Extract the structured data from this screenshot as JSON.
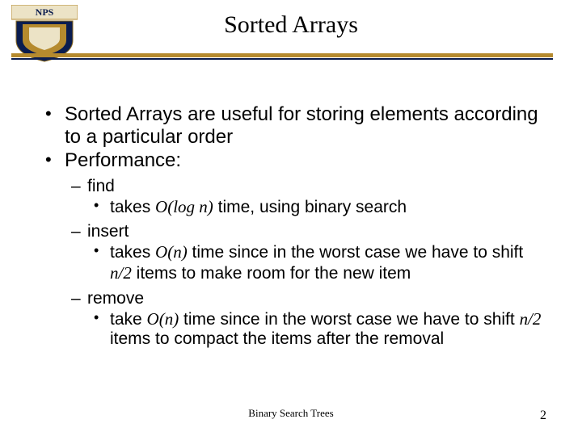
{
  "title": "Sorted Arrays",
  "bullets": {
    "b1a": "Sorted Arrays are useful for storing elements according to a particular order",
    "b1b": "Performance:",
    "find_label": "find",
    "find_detail_pre": "takes ",
    "find_O": "O",
    "find_paren_open": "(log ",
    "find_n": "n",
    "find_paren_close": ")",
    "find_detail_post": " time, using binary search",
    "insert_label": "insert",
    "insert_pre": "takes ",
    "insert_O": "O",
    "insert_open": "(",
    "insert_n": "n",
    "insert_close": ")",
    "insert_mid": " time since in the worst case we have to shift ",
    "insert_n2": "n",
    "insert_slash2": "/2",
    "insert_post": " items to make room for the new item",
    "remove_label": "remove",
    "remove_pre": "take ",
    "remove_O": "O",
    "remove_open": "(",
    "remove_n": "n",
    "remove_close": ")",
    "remove_mid": " time since in the worst case we have to shift ",
    "remove_n2": "n",
    "remove_slash2": "/2",
    "remove_post": " items to compact the items after the removal"
  },
  "footer": {
    "title": "Binary Search Trees",
    "page": "2"
  }
}
